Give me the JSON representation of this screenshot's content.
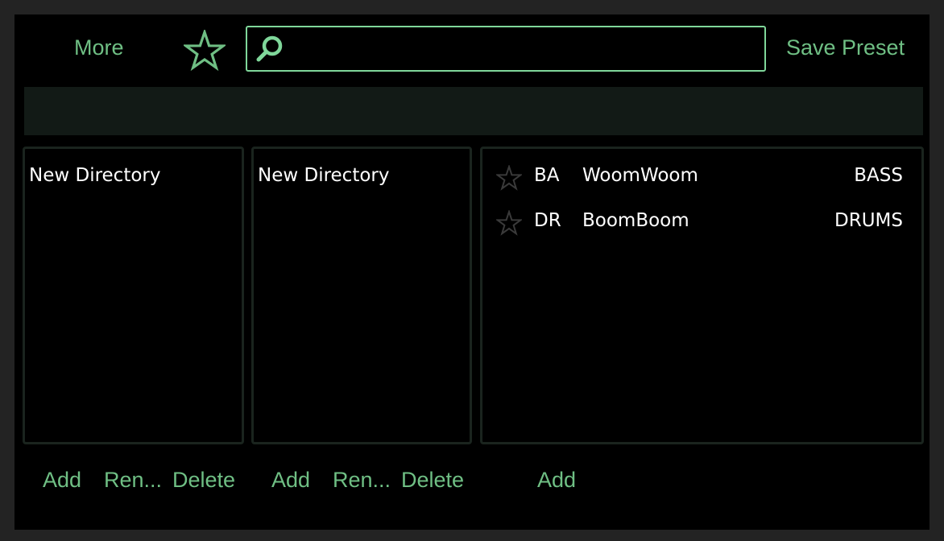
{
  "toolbar": {
    "more_label": "More",
    "favorites_icon": "star-outline-icon",
    "search": {
      "value": "",
      "placeholder": ""
    },
    "save_preset_label": "Save Preset"
  },
  "colors": {
    "accent": "#6fbf84",
    "search_border": "#7fd79a",
    "panel_border": "#1a241e",
    "tag_bar": "#121a16",
    "background": "#000000",
    "text": "#ffffff"
  },
  "directories": [
    {
      "items": [
        "New Directory"
      ],
      "actions": {
        "add": "Add",
        "rename": "Ren...",
        "delete": "Delete"
      }
    },
    {
      "items": [
        "New Directory"
      ],
      "actions": {
        "add": "Add",
        "rename": "Ren...",
        "delete": "Delete"
      }
    }
  ],
  "presets": {
    "rows": [
      {
        "favorite": false,
        "abbr": "BA",
        "name": "WoomWoom",
        "category": "BASS"
      },
      {
        "favorite": false,
        "abbr": "DR",
        "name": "BoomBoom",
        "category": "DRUMS"
      }
    ],
    "actions": {
      "add": "Add"
    }
  }
}
